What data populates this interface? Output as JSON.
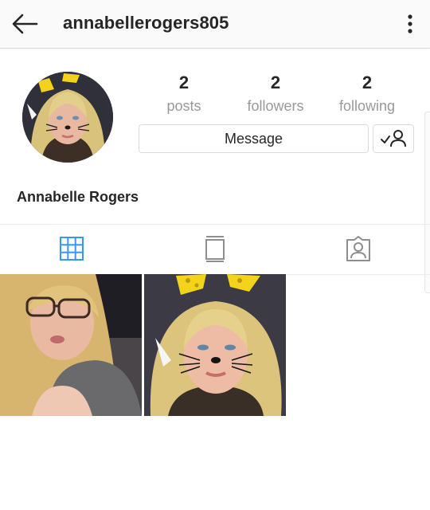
{
  "header": {
    "username": "annabellerogers805",
    "back_icon": "arrow-left-icon",
    "menu_icon": "more-vertical-icon"
  },
  "profile": {
    "full_name": "Annabelle Rogers",
    "avatar_icon": "profile-photo"
  },
  "stats": [
    {
      "value": "2",
      "label": "posts"
    },
    {
      "value": "2",
      "label": "followers"
    },
    {
      "value": "2",
      "label": "following"
    }
  ],
  "actions": {
    "message_label": "Message",
    "follow_icon": "following-check-user-icon"
  },
  "tabs": [
    {
      "name": "grid",
      "icon": "grid-icon",
      "active": true
    },
    {
      "name": "feed",
      "icon": "feed-icon",
      "active": false
    },
    {
      "name": "tagged",
      "icon": "tagged-user-icon",
      "active": false
    }
  ],
  "colors": {
    "accent": "#3897f0",
    "icon_muted": "#8e8e8e",
    "text": "#262626",
    "secondary_text": "#999999",
    "border": "#dbdbdb"
  }
}
